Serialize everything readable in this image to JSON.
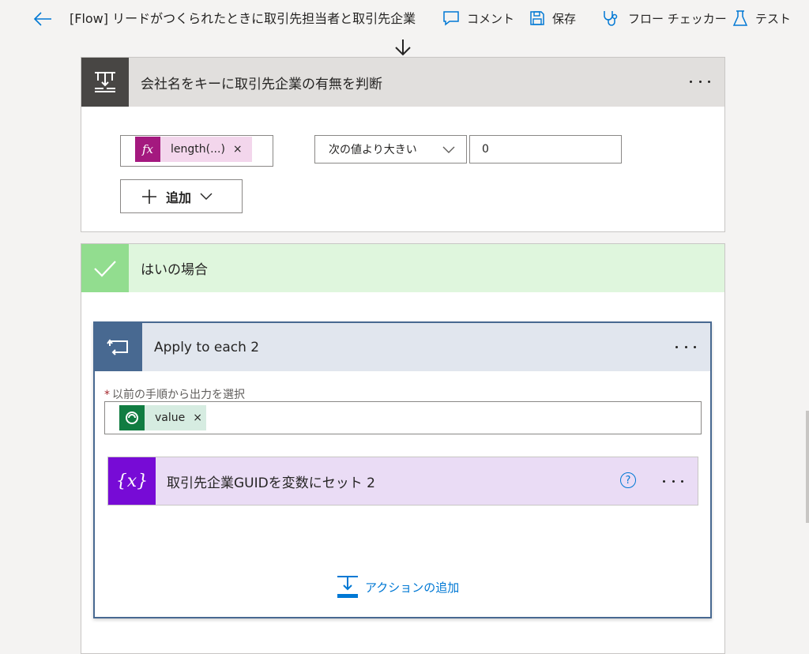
{
  "topbar": {
    "title": "[Flow] リードがつくられたときに取引先担当者と取引先企業",
    "comment_label": "コメント",
    "save_label": "保存",
    "checker_label": "フロー チェッカー",
    "test_label": "テスト"
  },
  "condition": {
    "title": "会社名をキーに取引先企業の有無を判断",
    "token_label": "length(...)",
    "token_remove": "×",
    "operator": "次の値より大きい",
    "value": "0",
    "add_label": "追加"
  },
  "yes_branch": {
    "title": "はいの場合"
  },
  "apply_each": {
    "title": "Apply to each 2",
    "field_required": "*",
    "field_label": "以前の手順から出力を選択",
    "token_label": "value",
    "token_remove": "×",
    "action_title": "取引先企業GUIDを変数にセット 2",
    "help": "?",
    "add_action_label": "アクションの追加"
  },
  "colors": {
    "accent": "#0078d4",
    "condition_icon": "#484644",
    "yes_icon": "#92dd8f",
    "loop_icon": "#486991",
    "variable_icon": "#770bd6",
    "expression_token": "#a4197f",
    "dynamic_token": "#107c41"
  }
}
